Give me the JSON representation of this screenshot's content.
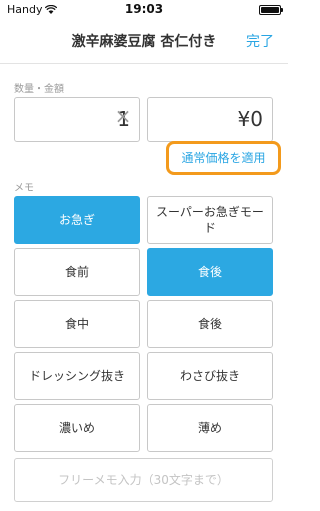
{
  "status_bar": {
    "carrier": "Handy",
    "time": "19:03"
  },
  "nav": {
    "title": "激辛麻婆豆腐 杏仁付き",
    "done_label": "完了"
  },
  "quantity": {
    "section_label": "数量・金額",
    "quantity_value": "1",
    "times_symbol": "×",
    "amount_value": "¥0"
  },
  "price_button": {
    "label": "通常価格を適用"
  },
  "memo": {
    "section_label": "メモ",
    "options": [
      {
        "label": "お急ぎ",
        "selected": true
      },
      {
        "label": "スーパーお急ぎモード",
        "selected": false
      },
      {
        "label": "食前",
        "selected": false
      },
      {
        "label": "食後",
        "selected": true
      },
      {
        "label": "食中",
        "selected": false
      },
      {
        "label": "食後",
        "selected": false
      },
      {
        "label": "ドレッシング抜き",
        "selected": false
      },
      {
        "label": "わさび抜き",
        "selected": false
      },
      {
        "label": "濃いめ",
        "selected": false
      },
      {
        "label": "薄め",
        "selected": false
      }
    ],
    "free_input_placeholder": "フリーメモ入力（30文字まで）"
  },
  "colors": {
    "accent": "#2ca8e2",
    "highlight": "#f39a1c"
  }
}
